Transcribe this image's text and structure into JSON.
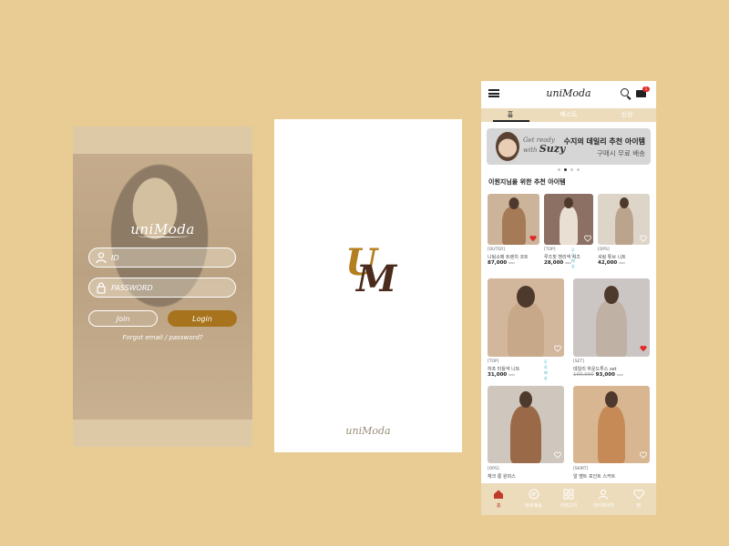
{
  "login": {
    "logo": "uniModa",
    "id_placeholder": "ID",
    "password_placeholder": "PASSWORD",
    "join_label": "Join",
    "login_label": "Login",
    "forgot_label": "Forgot email / password?"
  },
  "splash": {
    "mono_u": "U",
    "mono_m": "M",
    "footer_logo": "uniModa"
  },
  "shop": {
    "brand": "uniModa",
    "cart_count": "1",
    "tabs": [
      {
        "label": "홈"
      },
      {
        "label": "베스트"
      },
      {
        "label": "신상"
      }
    ],
    "banner": {
      "script_line1": "Get ready",
      "script_line2": "with",
      "script_name": "Suzy",
      "title": "수지의 데일리 추천 아이템",
      "subtitle": "구매시 무료 배송"
    },
    "section_title": "이원지님을 위한 추천 아이템",
    "products": [
      {
        "category": "[OUTER]",
        "name": "니팅소매 트렌치 코트",
        "price": "87,000",
        "unit": "won",
        "liked": true
      },
      {
        "category": "[TOP]",
        "name": "루즈핏 헨리넥 셔츠",
        "price": "28,000",
        "unit": "won",
        "free_label": "무료배송",
        "liked": false
      },
      {
        "category": "[OPS]",
        "name": "셔링 튜브 니트",
        "price": "42,000",
        "unit": "won",
        "liked": false
      },
      {
        "category": "[TOP]",
        "name": "하프 터틀넥 니트",
        "price": "31,000",
        "unit": "won",
        "free_label": "무료배송",
        "liked": false
      },
      {
        "category": "[SET]",
        "name": "데일리 하운드투스 set",
        "original_price": "100,000",
        "price": "93,000",
        "unit": "won",
        "liked": true
      },
      {
        "category": "[OPS]",
        "name": "체크 롱 원피스",
        "liked": false
      },
      {
        "category": "[SKIRT]",
        "name": "알 벨트 포인트 스커트",
        "liked": false
      }
    ],
    "nav": [
      {
        "label": "홈"
      },
      {
        "label": "바로배송"
      },
      {
        "label": "카테고리"
      },
      {
        "label": "마이페이지"
      },
      {
        "label": "찜"
      }
    ],
    "colors": {
      "accent": "#a7731c",
      "background": "#e8cc94",
      "tab_bar": "#ecdcbc",
      "badge": "#e02a2a"
    }
  }
}
